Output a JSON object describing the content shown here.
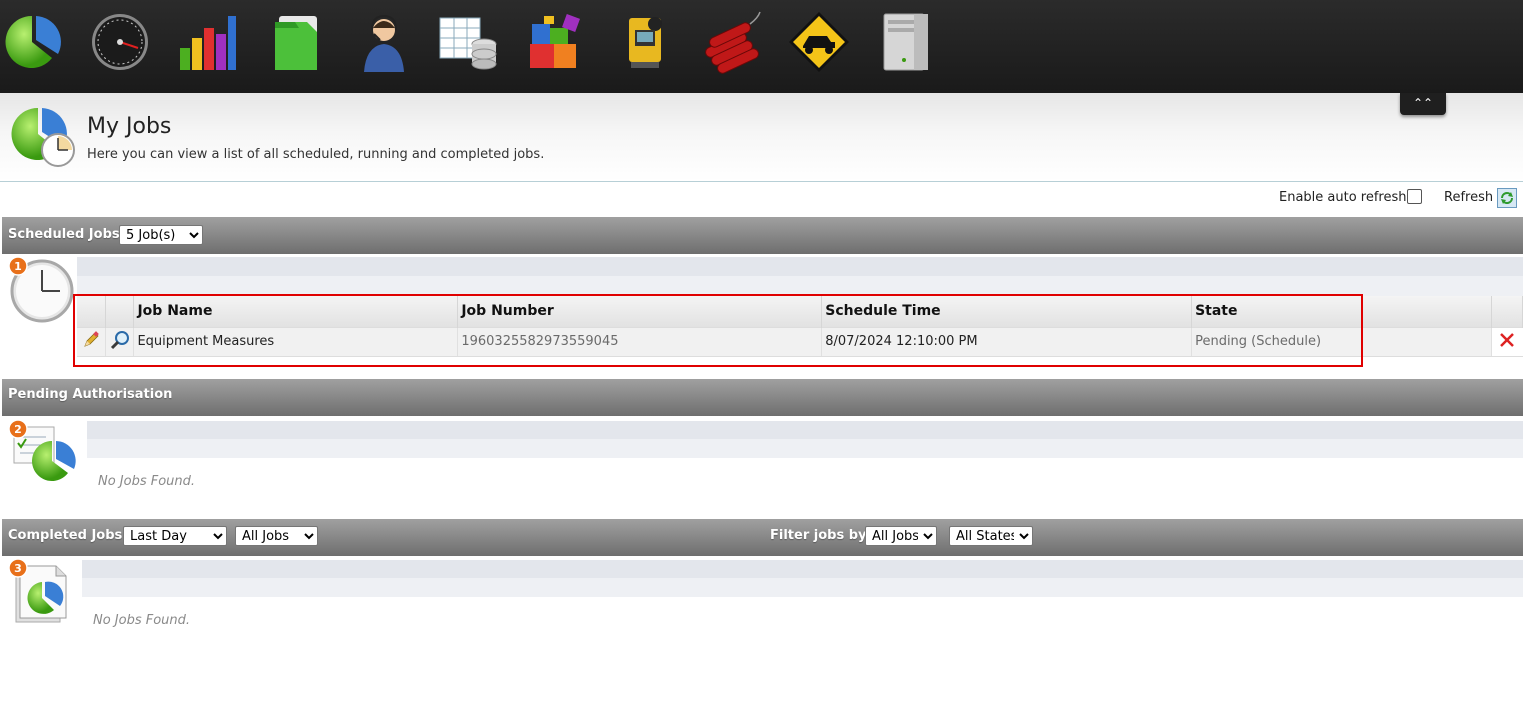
{
  "toolbar": {
    "icons": [
      "jobs-pie-chart-icon",
      "speedometer-icon",
      "bar-chart-icon",
      "green-folder-icon",
      "support-headset-icon",
      "spreadsheet-database-icon",
      "building-blocks-icon",
      "surveying-instrument-icon",
      "dynamite-icon",
      "truck-warning-sign-icon",
      "server-tower-icon"
    ]
  },
  "header": {
    "collapse_glyph": "⌃",
    "title": "My Jobs",
    "description": "Here you can view a list of all scheduled, running and completed jobs."
  },
  "refresh": {
    "auto_label": "Enable auto refresh",
    "auto_checked": false,
    "refresh_label": "Refresh"
  },
  "scheduled": {
    "title": "Scheduled Jobs",
    "count_select": "5 Job(s)",
    "badge": "1",
    "columns": [
      "Job Name",
      "Job Number",
      "Schedule Time",
      "State"
    ],
    "rows": [
      {
        "name": "Equipment Measures",
        "number": "1960325582973559045",
        "schedule_time": "8/07/2024 12:10:00 PM",
        "state": "Pending (Schedule)"
      }
    ]
  },
  "pending": {
    "title": "Pending Authorisation",
    "badge": "2",
    "empty_text": "No Jobs Found."
  },
  "completed": {
    "title": "Completed Jobs",
    "period_select": "Last Day",
    "jobs_select": "All Jobs",
    "filter_label": "Filter jobs by",
    "filter_jobs_select": "All Jobs",
    "filter_states_select": "All States",
    "badge": "3",
    "empty_text": "No Jobs Found."
  },
  "colors": {
    "highlight": "#e00000",
    "delete": "#dd2222",
    "section_bar": "#8a8a8a"
  }
}
